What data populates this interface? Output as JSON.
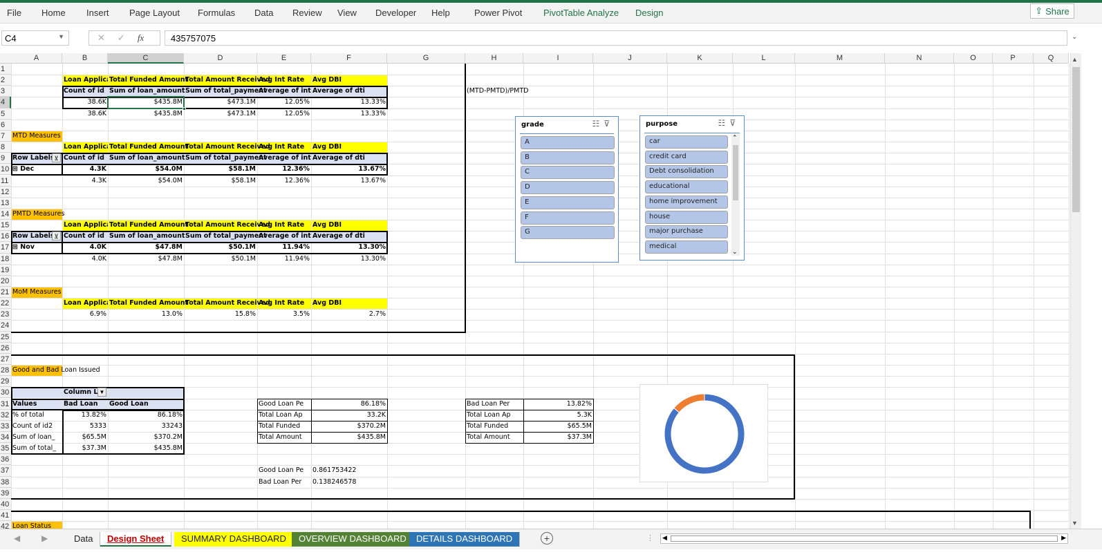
{
  "ribbon": {
    "tabs": [
      "File",
      "Home",
      "Insert",
      "Page Layout",
      "Formulas",
      "Data",
      "Review",
      "View",
      "Developer",
      "Help",
      "Power Pivot",
      "PivotTable Analyze",
      "Design"
    ],
    "share": "Share"
  },
  "formula_bar": {
    "name_box": "C4",
    "formula": "435757075"
  },
  "columns": [
    "A",
    "B",
    "C",
    "D",
    "E",
    "F",
    "G",
    "H",
    "I",
    "J",
    "K",
    "L",
    "M",
    "N",
    "O",
    "P",
    "Q"
  ],
  "selected_cell": "C4",
  "cells": [
    {
      "r": "B2",
      "v": "Loan Applica",
      "c": "b clip"
    },
    {
      "r": "C2",
      "v": "Total Funded Amount",
      "c": "b"
    },
    {
      "r": "D2",
      "v": "Total Amount Received",
      "c": "b"
    },
    {
      "r": "E2",
      "v": "Avg Int Rate",
      "c": "b"
    },
    {
      "r": "F2",
      "v": "Avg DBI",
      "c": "b"
    },
    {
      "r": "B3",
      "v": "Count of id",
      "c": "b"
    },
    {
      "r": "C3",
      "v": "Sum of loan_amount",
      "c": "b"
    },
    {
      "r": "D3",
      "v": "Sum of total_payment",
      "c": "b"
    },
    {
      "r": "E3",
      "v": "Average of int",
      "c": "b clip"
    },
    {
      "r": "F3",
      "v": "Average of dti",
      "c": "b"
    },
    {
      "r": "B4",
      "v": "38.6K",
      "c": "r"
    },
    {
      "r": "C4",
      "v": "$435.8M",
      "c": "r"
    },
    {
      "r": "D4",
      "v": "$473.1M",
      "c": "r"
    },
    {
      "r": "E4",
      "v": "12.05%",
      "c": "r"
    },
    {
      "r": "F4",
      "v": "13.33%",
      "c": "r"
    },
    {
      "r": "B5",
      "v": "38.6K",
      "c": "r"
    },
    {
      "r": "C5",
      "v": "$435.8M",
      "c": "r"
    },
    {
      "r": "D5",
      "v": "$473.1M",
      "c": "r"
    },
    {
      "r": "E5",
      "v": "12.05%",
      "c": "r"
    },
    {
      "r": "F5",
      "v": "13.33%",
      "c": "r"
    },
    {
      "r": "H3",
      "v": "(MTD-PMTD)/PMTD",
      "c": ""
    },
    {
      "r": "A7",
      "v": "MTD Measures",
      "c": ""
    },
    {
      "r": "B8",
      "v": "Loan Applica",
      "c": "b clip"
    },
    {
      "r": "C8",
      "v": "Total Funded Amount",
      "c": "b"
    },
    {
      "r": "D8",
      "v": "Total Amount Received",
      "c": "b"
    },
    {
      "r": "E8",
      "v": "Avg Int Rate",
      "c": "b"
    },
    {
      "r": "F8",
      "v": "Avg DBI",
      "c": "b"
    },
    {
      "r": "A9",
      "v": "Row Labels",
      "c": "b clip"
    },
    {
      "r": "B9",
      "v": "Count of id",
      "c": "b"
    },
    {
      "r": "C9",
      "v": "Sum of loan_amount",
      "c": "b"
    },
    {
      "r": "D9",
      "v": "Sum of total_payment",
      "c": "b"
    },
    {
      "r": "E9",
      "v": "Average of int",
      "c": "b clip"
    },
    {
      "r": "F9",
      "v": "Average of dti",
      "c": "b"
    },
    {
      "r": "A10",
      "v": "⊞ Dec",
      "c": "b"
    },
    {
      "r": "B10",
      "v": "4.3K",
      "c": "r b"
    },
    {
      "r": "C10",
      "v": "$54.0M",
      "c": "r b"
    },
    {
      "r": "D10",
      "v": "$58.1M",
      "c": "r b"
    },
    {
      "r": "E10",
      "v": "12.36%",
      "c": "r b"
    },
    {
      "r": "F10",
      "v": "13.67%",
      "c": "r b"
    },
    {
      "r": "B11",
      "v": "4.3K",
      "c": "r"
    },
    {
      "r": "C11",
      "v": "$54.0M",
      "c": "r"
    },
    {
      "r": "D11",
      "v": "$58.1M",
      "c": "r"
    },
    {
      "r": "E11",
      "v": "12.36%",
      "c": "r"
    },
    {
      "r": "F11",
      "v": "13.67%",
      "c": "r"
    },
    {
      "r": "A14",
      "v": "PMTD Measures",
      "c": ""
    },
    {
      "r": "B15",
      "v": "Loan Applica",
      "c": "b clip"
    },
    {
      "r": "C15",
      "v": "Total Funded Amount",
      "c": "b"
    },
    {
      "r": "D15",
      "v": "Total Amount Received",
      "c": "b"
    },
    {
      "r": "E15",
      "v": "Avg Int Rate",
      "c": "b"
    },
    {
      "r": "F15",
      "v": "Avg DBI",
      "c": "b"
    },
    {
      "r": "A16",
      "v": "Row Labels",
      "c": "b clip"
    },
    {
      "r": "B16",
      "v": "Count of id",
      "c": "b"
    },
    {
      "r": "C16",
      "v": "Sum of loan_amount",
      "c": "b"
    },
    {
      "r": "D16",
      "v": "Sum of total_payment",
      "c": "b"
    },
    {
      "r": "E16",
      "v": "Average of int",
      "c": "b clip"
    },
    {
      "r": "F16",
      "v": "Average of dti",
      "c": "b"
    },
    {
      "r": "A17",
      "v": "⊞ Nov",
      "c": "b"
    },
    {
      "r": "B17",
      "v": "4.0K",
      "c": "r b"
    },
    {
      "r": "C17",
      "v": "$47.8M",
      "c": "r b"
    },
    {
      "r": "D17",
      "v": "$50.1M",
      "c": "r b"
    },
    {
      "r": "E17",
      "v": "11.94%",
      "c": "r b"
    },
    {
      "r": "F17",
      "v": "13.30%",
      "c": "r b"
    },
    {
      "r": "B18",
      "v": "4.0K",
      "c": "r"
    },
    {
      "r": "C18",
      "v": "$47.8M",
      "c": "r"
    },
    {
      "r": "D18",
      "v": "$50.1M",
      "c": "r"
    },
    {
      "r": "E18",
      "v": "11.94%",
      "c": "r"
    },
    {
      "r": "F18",
      "v": "13.30%",
      "c": "r"
    },
    {
      "r": "A21",
      "v": "MoM Measures",
      "c": ""
    },
    {
      "r": "B22",
      "v": "Loan Applica",
      "c": "b clip"
    },
    {
      "r": "C22",
      "v": "Total Funded Amount",
      "c": "b"
    },
    {
      "r": "D22",
      "v": "Total Amount Received",
      "c": "b"
    },
    {
      "r": "E22",
      "v": "Avg Int Rate",
      "c": "b"
    },
    {
      "r": "F22",
      "v": "Avg DBI",
      "c": "b"
    },
    {
      "r": "B23",
      "v": "6.9%",
      "c": "r"
    },
    {
      "r": "C23",
      "v": "13.0%",
      "c": "r"
    },
    {
      "r": "D23",
      "v": "15.8%",
      "c": "r"
    },
    {
      "r": "E23",
      "v": "3.5%",
      "c": "r"
    },
    {
      "r": "F23",
      "v": "2.7%",
      "c": "r"
    },
    {
      "r": "A28",
      "v": "Good and Bad Loan Issued",
      "c": ""
    },
    {
      "r": "B30",
      "v": "Column L",
      "c": "b clip"
    },
    {
      "r": "A31",
      "v": "Values",
      "c": "b"
    },
    {
      "r": "B31",
      "v": "Bad Loan",
      "c": "b"
    },
    {
      "r": "C31",
      "v": "Good Loan",
      "c": "b"
    },
    {
      "r": "A32",
      "v": "% of total",
      "c": "clip"
    },
    {
      "r": "B32",
      "v": "13.82%",
      "c": "r"
    },
    {
      "r": "C32",
      "v": "86.18%",
      "c": "r"
    },
    {
      "r": "A33",
      "v": "Count of id2",
      "c": "clip"
    },
    {
      "r": "B33",
      "v": "5333",
      "c": "r"
    },
    {
      "r": "C33",
      "v": "33243",
      "c": "r"
    },
    {
      "r": "A34",
      "v": "Sum of loan_",
      "c": "clip"
    },
    {
      "r": "B34",
      "v": "$65.5M",
      "c": "r"
    },
    {
      "r": "C34",
      "v": "$370.2M",
      "c": "r"
    },
    {
      "r": "A35",
      "v": "Sum of total_",
      "c": "clip"
    },
    {
      "r": "B35",
      "v": "$37.3M",
      "c": "r"
    },
    {
      "r": "C35",
      "v": "$435.8M",
      "c": "r"
    },
    {
      "r": "E31",
      "v": "Good Loan Pe",
      "c": "clip"
    },
    {
      "r": "F31",
      "v": "86.18%",
      "c": "r"
    },
    {
      "r": "E32",
      "v": "Total Loan Ap",
      "c": "clip"
    },
    {
      "r": "F32",
      "v": "33.2K",
      "c": "r"
    },
    {
      "r": "E33",
      "v": "Total Funded",
      "c": "clip"
    },
    {
      "r": "F33",
      "v": "$370.2M",
      "c": "r"
    },
    {
      "r": "E34",
      "v": "Total Amount",
      "c": "clip"
    },
    {
      "r": "F34",
      "v": "$435.8M",
      "c": "r"
    },
    {
      "r": "H31",
      "v": "Bad Loan Per",
      "c": "clip"
    },
    {
      "r": "I31",
      "v": "13.82%",
      "c": "r"
    },
    {
      "r": "H32",
      "v": "Total Loan Ap",
      "c": "clip"
    },
    {
      "r": "I32",
      "v": "5.3K",
      "c": "r"
    },
    {
      "r": "H33",
      "v": "Total Funded",
      "c": "clip"
    },
    {
      "r": "I33",
      "v": "$65.5M",
      "c": "r"
    },
    {
      "r": "H34",
      "v": "Total Amount",
      "c": "clip"
    },
    {
      "r": "I34",
      "v": "$37.3M",
      "c": "r"
    },
    {
      "r": "E37",
      "v": "Good Loan Pe",
      "c": "clip"
    },
    {
      "r": "F37",
      "v": "0.861753422",
      "c": ""
    },
    {
      "r": "E38",
      "v": "Bad Loan Per",
      "c": "clip"
    },
    {
      "r": "F38",
      "v": "0.138246578",
      "c": ""
    },
    {
      "r": "A42",
      "v": "Loan Status",
      "c": ""
    }
  ],
  "colors": {
    "header_yellow": "#ffff00",
    "pivot_blue": "#d9e1f2",
    "section_orange": "#ffc000",
    "excel_green": "#217346"
  },
  "slicers": {
    "grade": {
      "title": "grade",
      "items": [
        "A",
        "B",
        "C",
        "D",
        "E",
        "F",
        "G"
      ]
    },
    "purpose": {
      "title": "purpose",
      "items": [
        "car",
        "credit card",
        "Debt consolidation",
        "educational",
        "home improvement",
        "house",
        "major purchase",
        "medical"
      ]
    }
  },
  "donut": {
    "categories": [
      "Bad Loan",
      "Good Loan"
    ],
    "values": [
      13.82,
      86.18
    ],
    "colors": [
      "#ed7d31",
      "#4472c4"
    ]
  },
  "sheet_tabs": [
    {
      "label": "Data",
      "bg": "#f3f3f3",
      "fg": "#222"
    },
    {
      "label": "Design Sheet",
      "bg": "#ffffff",
      "fg": "#c00000",
      "active": true
    },
    {
      "label": "SUMMARY DASHBOARD",
      "bg": "#ffff00",
      "fg": "#222"
    },
    {
      "label": "OVERVIEW DASHBOARD",
      "bg": "#548235",
      "fg": "#ffffff"
    },
    {
      "label": "DETAILS DASHBOARD",
      "bg": "#2e75b6",
      "fg": "#ffffff"
    }
  ]
}
